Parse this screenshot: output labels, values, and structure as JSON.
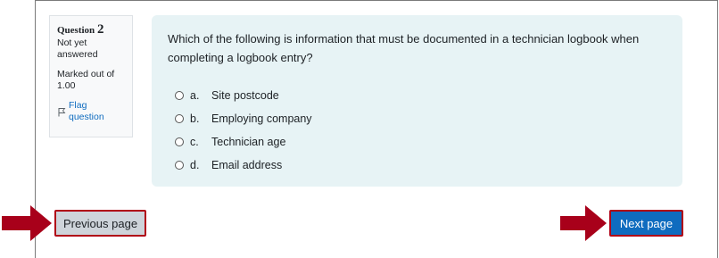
{
  "question": {
    "label": "Question",
    "number": "2",
    "status": "Not yet answered",
    "marked_out_of_label": "Marked out of",
    "marked_out_of_value": "1.00",
    "flag_label": "Flag question",
    "text": "Which of the following is information that must be documented in a technician logbook when completing a logbook entry?",
    "options": [
      {
        "letter": "a.",
        "text": "Site postcode"
      },
      {
        "letter": "b.",
        "text": "Employing company"
      },
      {
        "letter": "c.",
        "text": "Technician age"
      },
      {
        "letter": "d.",
        "text": "Email address"
      }
    ]
  },
  "navigation": {
    "previous_label": "Previous page",
    "next_label": "Next page"
  },
  "colors": {
    "accent": "#0f6cbf",
    "highlight_border": "#b00016",
    "arrow": "#a8001a",
    "content_bg": "#e7f3f5"
  },
  "icons": {
    "flag": "flag-outline-icon",
    "arrow": "right-arrow-icon",
    "radio": "radio-unchecked-icon"
  }
}
